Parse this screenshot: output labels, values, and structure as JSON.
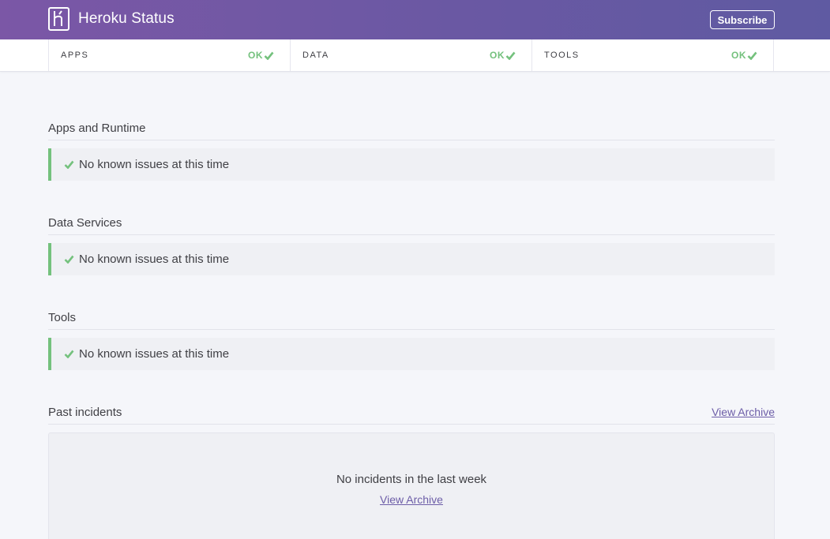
{
  "header": {
    "title": "Heroku Status",
    "subscribe_label": "Subscribe"
  },
  "status": [
    {
      "name": "APPS",
      "state": "OK"
    },
    {
      "name": "DATA",
      "state": "OK"
    },
    {
      "name": "TOOLS",
      "state": "OK"
    }
  ],
  "sections": [
    {
      "title": "Apps and Runtime",
      "message": "No known issues at this time"
    },
    {
      "title": "Data Services",
      "message": "No known issues at this time"
    },
    {
      "title": "Tools",
      "message": "No known issues at this time"
    }
  ],
  "past_incidents": {
    "title": "Past incidents",
    "archive_label": "View Archive",
    "empty_message": "No incidents in the last week",
    "empty_archive_label": "View Archive"
  },
  "colors": {
    "header_start": "#7b57a6",
    "header_end": "#5f5aa2",
    "ok_green": "#74c17d",
    "link_purple": "#6d5ea8"
  }
}
